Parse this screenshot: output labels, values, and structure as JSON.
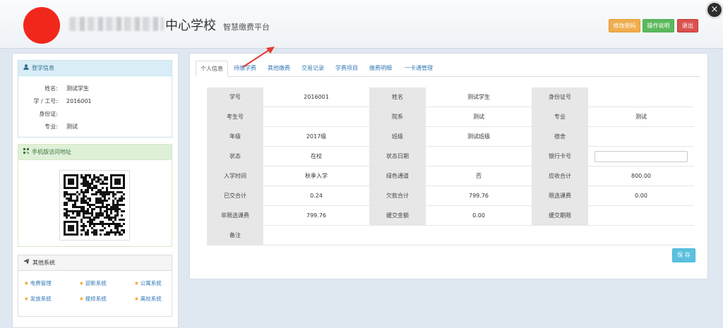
{
  "header": {
    "school_title": "中心学校",
    "platform_subtitle": "智慧缴费平台",
    "buttons": {
      "change_password": "修改密码",
      "instructions": "操作说明",
      "logout": "退出"
    },
    "close": "×"
  },
  "sidebar": {
    "login_panel": {
      "title": "登学信息",
      "rows": [
        {
          "label": "姓名:",
          "value": "测试学生"
        },
        {
          "label": "学 / 工号:",
          "value": "2016001"
        },
        {
          "label": "身份证:",
          "value": ""
        },
        {
          "label": "专业:",
          "value": "测试"
        }
      ]
    },
    "mobile_panel": {
      "title": "手机版访问地址"
    },
    "other_panel": {
      "title": "其他系统",
      "links": [
        "电费管理",
        "迎新系统",
        "公寓系统",
        "发放系统",
        "报修系统",
        "离校系统"
      ]
    }
  },
  "main": {
    "tabs": [
      "个人信息",
      "待缴学费",
      "其他缴费",
      "交易记录",
      "学费项目",
      "缴费明细",
      "一卡通管理"
    ],
    "active_tab": "个人信息",
    "table": [
      [
        "学号",
        "2016001",
        "姓名",
        "测试学生",
        "身份证号",
        ""
      ],
      [
        "考生号",
        "",
        "院系",
        "测试",
        "专业",
        "测试"
      ],
      [
        "年级",
        "2017级",
        "班级",
        "测试班级",
        "宿舍",
        ""
      ],
      [
        "状态",
        "在校",
        "状态日期",
        "",
        "银行卡号",
        ""
      ],
      [
        "入学时间",
        "秋季入学",
        "绿色通道",
        "否",
        "应收合计",
        "800.00"
      ],
      [
        "已交合计",
        "0.24",
        "欠款合计",
        "799.76",
        "限选课费",
        "0.00"
      ],
      [
        "非限选课费",
        "799.76",
        "缓交金额",
        "0.00",
        "缓交期限",
        ""
      ],
      [
        "备注",
        ""
      ]
    ],
    "save_label": "保 存"
  },
  "colors": {
    "logo_red": "#f2271b",
    "change_password": "#f0ad4e",
    "instructions": "#5cb85c",
    "logout": "#d9534f",
    "save": "#5bc0de",
    "arrow": "#e53935"
  },
  "icons": {
    "login_panel": "user-icon",
    "mobile_panel": "qrcode-icon",
    "other_panel": "paper-plane-icon",
    "link_bullet": "star-icon",
    "close": "close-icon"
  }
}
